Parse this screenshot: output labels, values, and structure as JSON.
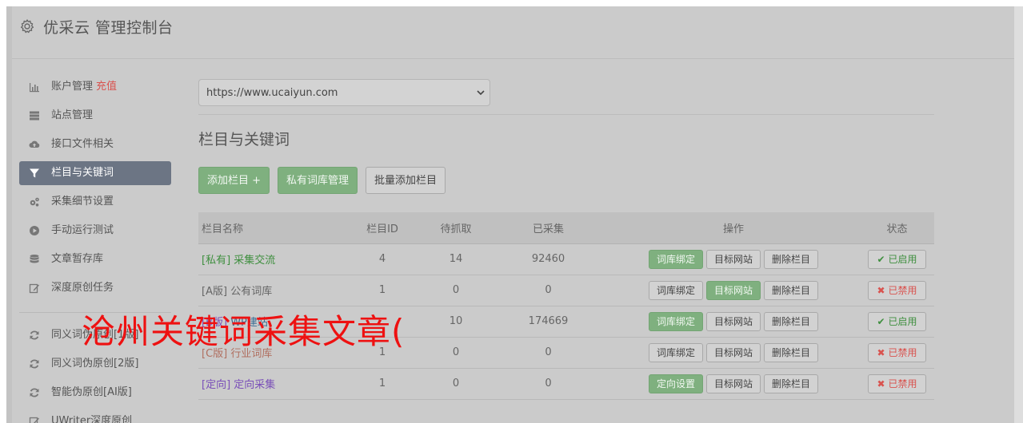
{
  "app": {
    "title": "优采云 管理控制台"
  },
  "sidebar": {
    "items": [
      {
        "label": "账户管理",
        "extra": "充值",
        "icon": "bar-chart-icon"
      },
      {
        "label": "站点管理",
        "icon": "server-icon"
      },
      {
        "label": "接口文件相关",
        "icon": "cloud-upload-icon"
      },
      {
        "label": "栏目与关键词",
        "icon": "filter-icon",
        "active": true
      },
      {
        "label": "采集细节设置",
        "icon": "gears-icon"
      },
      {
        "label": "手动运行测试",
        "icon": "play-circle-icon"
      },
      {
        "label": "文章暂存库",
        "icon": "database-icon"
      },
      {
        "label": "深度原创任务",
        "icon": "edit-icon"
      }
    ],
    "items2": [
      {
        "label": "同义词伪原创[1版]",
        "icon": "refresh-icon"
      },
      {
        "label": "同义词伪原创[2版]",
        "icon": "refresh-icon"
      },
      {
        "label": "智能伪原创[AI版]",
        "icon": "refresh-icon"
      },
      {
        "label": "UWriter深度原创",
        "icon": "edit-icon"
      }
    ]
  },
  "site_select": {
    "value": "https://www.ucaiyun.com"
  },
  "section": {
    "title": "栏目与关键词"
  },
  "toolbar": {
    "add_column": "添加栏目 +",
    "private_lexicon": "私有词库管理",
    "batch_add": "批量添加栏目"
  },
  "table": {
    "headers": [
      "栏目名称",
      "栏目ID",
      "待抓取",
      "已采集",
      "操作",
      "状态"
    ],
    "rows": [
      {
        "tag": "[私有]",
        "name": "采集交流",
        "id": "4",
        "pending": "14",
        "collected": "92460",
        "op1": "词库绑定",
        "op2": "目标网站",
        "op3": "删除栏目",
        "status": "已启用"
      },
      {
        "tag": "[A版]",
        "name": "公有词库",
        "id": "1",
        "pending": "0",
        "collected": "0",
        "op1": "词库绑定",
        "op2": "目标网站",
        "op3": "删除栏目",
        "status": "已禁用"
      },
      {
        "tag": "[B版]",
        "name": "WP建站",
        "id": "",
        "pending": "10",
        "collected": "174669",
        "op1": "词库绑定",
        "op2": "目标网站",
        "op3": "删除栏目",
        "status": "已启用"
      },
      {
        "tag": "[C版]",
        "name": "行业词库",
        "id": "1",
        "pending": "0",
        "collected": "0",
        "op1": "词库绑定",
        "op2": "目标网站",
        "op3": "删除栏目",
        "status": "已禁用"
      },
      {
        "tag": "[定向]",
        "name": "定向采集",
        "id": "1",
        "pending": "0",
        "collected": "0",
        "op1": "定向设置",
        "op2": "目标网站",
        "op3": "删除栏目",
        "status": "已禁用"
      }
    ]
  },
  "watermark": {
    "text": "沧州关键词采集文章("
  }
}
